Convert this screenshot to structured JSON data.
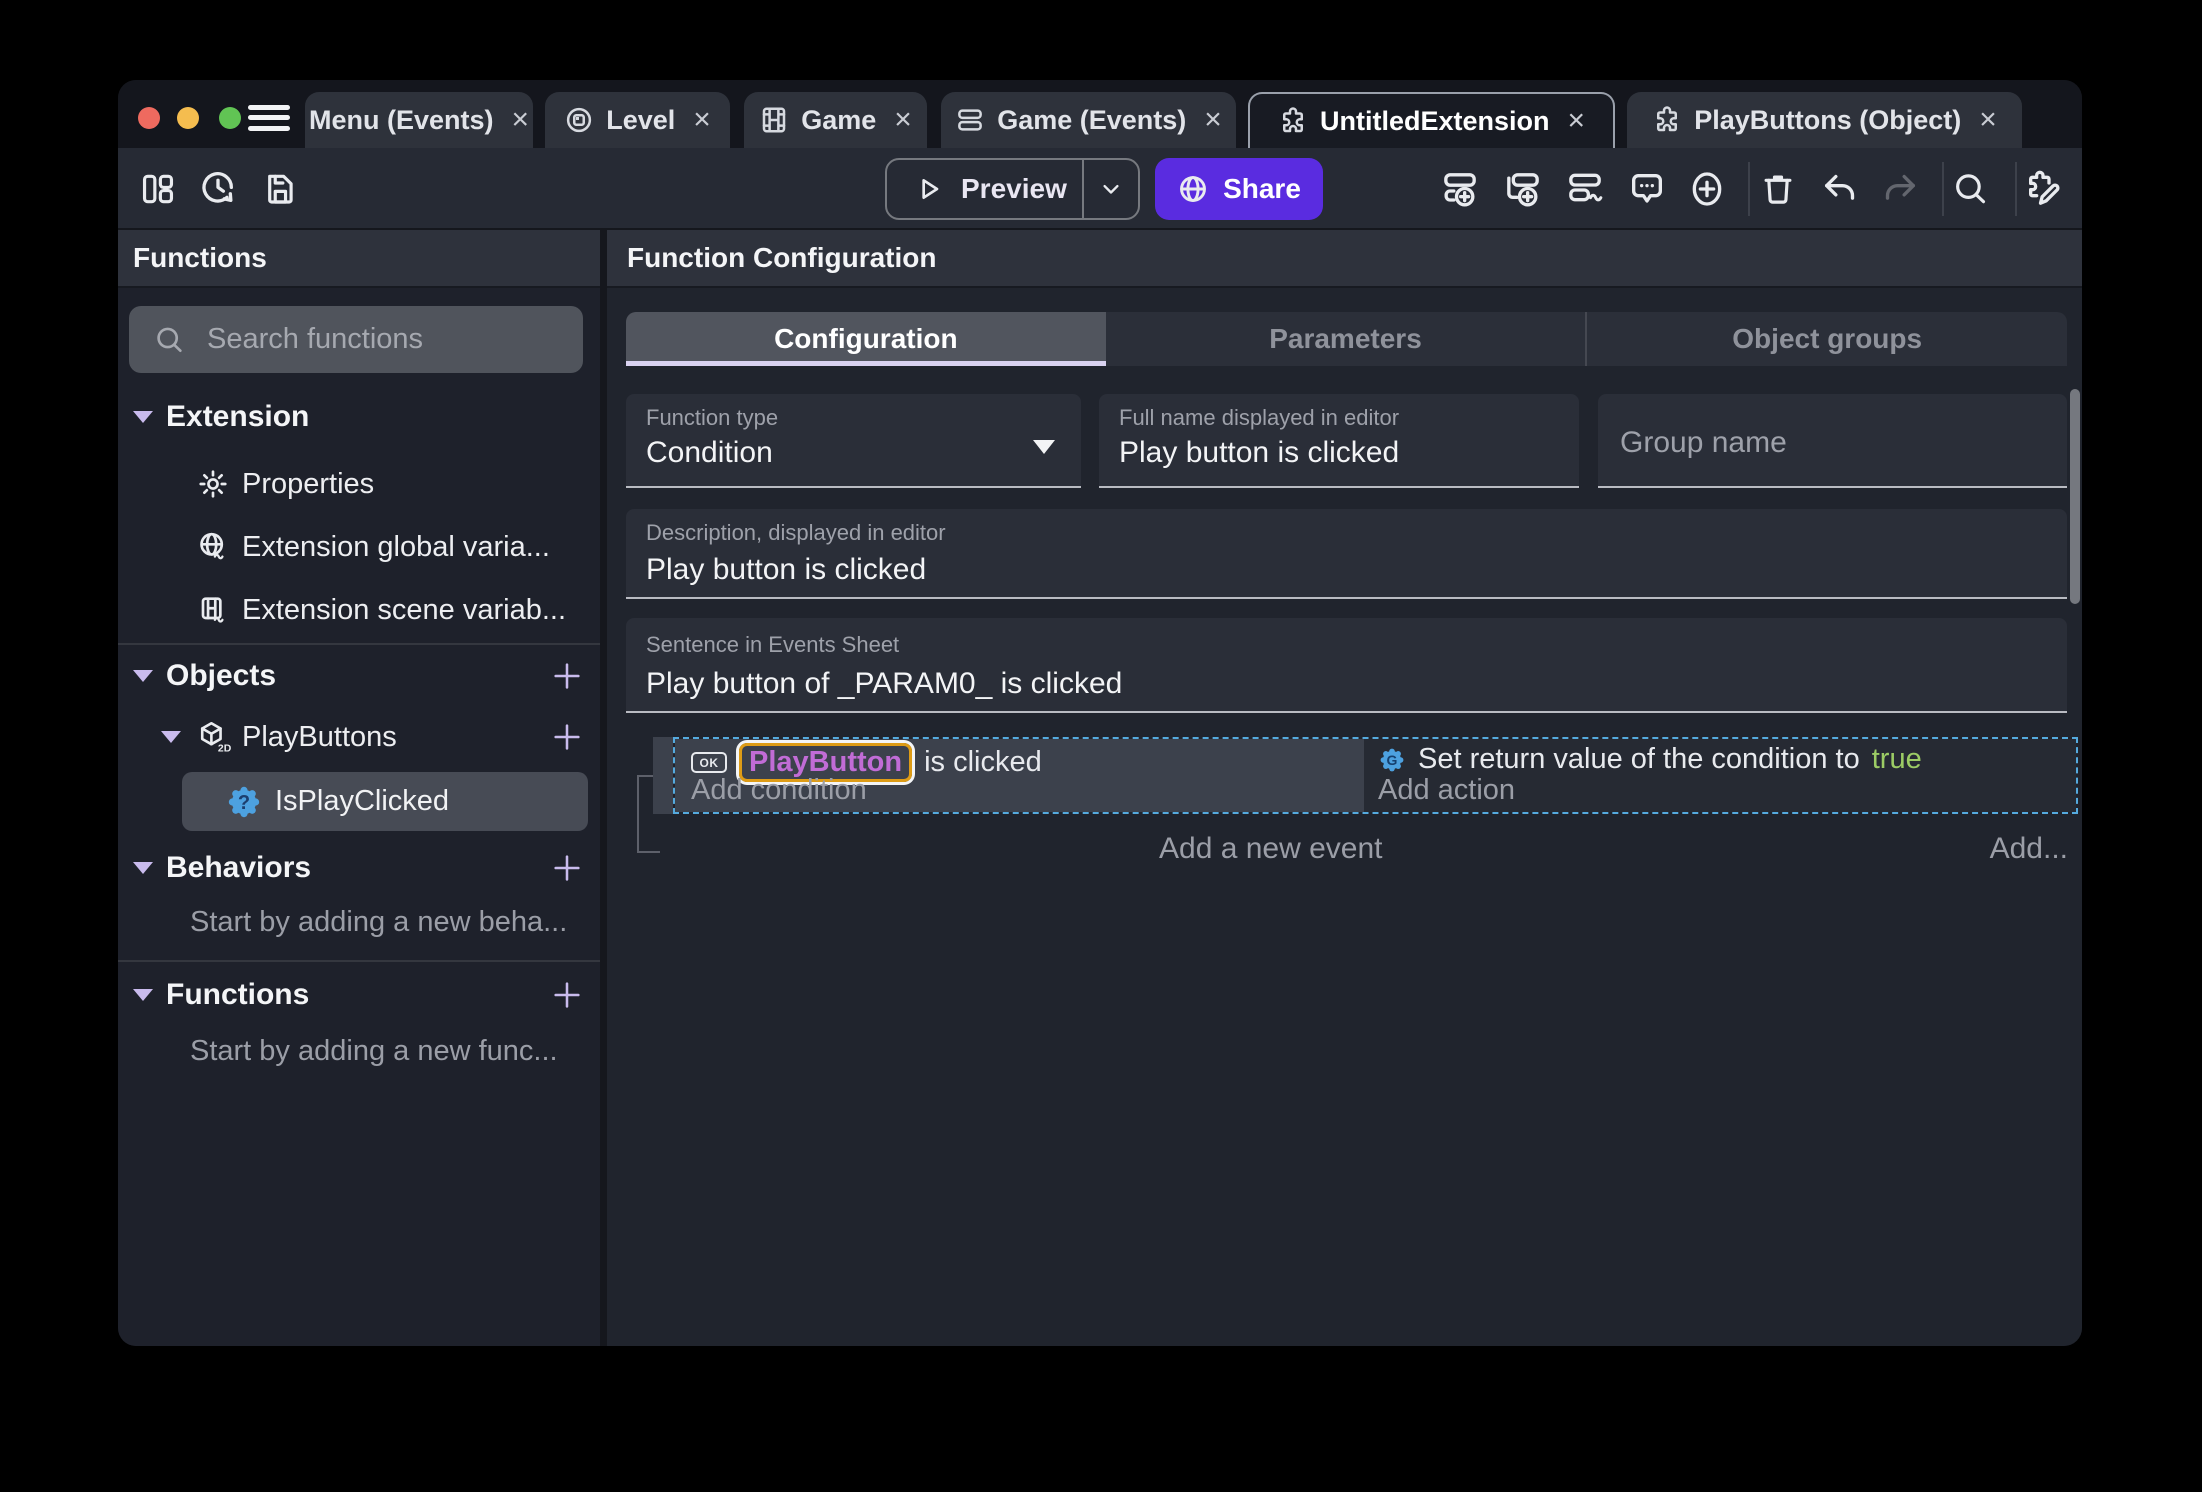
{
  "window": {
    "close_glyph": "×",
    "tabs": [
      {
        "label": "Menu (Events)",
        "icon": null
      },
      {
        "label": "Level",
        "icon": "level-icon"
      },
      {
        "label": "Game",
        "icon": "film-icon"
      },
      {
        "label": "Game (Events)",
        "icon": "events-sheet-icon"
      },
      {
        "label": "UntitledExtension",
        "icon": "puzzle-icon",
        "active": true
      },
      {
        "label": "PlayButtons (Object)",
        "icon": "puzzle-icon"
      }
    ]
  },
  "toolbar": {
    "preview_label": "Preview",
    "share_label": "Share"
  },
  "sidebar": {
    "header": "Functions",
    "search_placeholder": "Search functions",
    "extension": {
      "title": "Extension",
      "items": [
        "Properties",
        "Extension global varia...",
        "Extension scene variab..."
      ]
    },
    "objects": {
      "title": "Objects",
      "object_name": "PlayButtons",
      "function_name": "IsPlayClicked"
    },
    "behaviors": {
      "title": "Behaviors",
      "empty": "Start by adding a new beha..."
    },
    "functions": {
      "title": "Functions",
      "empty": "Start by adding a new func..."
    }
  },
  "main": {
    "header": "Function Configuration",
    "tabs": [
      "Configuration",
      "Parameters",
      "Object groups"
    ],
    "fields": {
      "function_type": {
        "label": "Function type",
        "value": "Condition"
      },
      "full_name": {
        "label": "Full name displayed in editor",
        "value": "Play button is clicked"
      },
      "group_name": {
        "placeholder": "Group name"
      },
      "description": {
        "label": "Description, displayed in editor",
        "value": "Play button is clicked"
      },
      "sentence": {
        "label": "Sentence in Events Sheet",
        "value": "Play button of _PARAM0_ is clicked"
      }
    }
  },
  "events": {
    "condition": {
      "badge": "OK",
      "object": "PlayButton",
      "rest": " is clicked",
      "add_label": "Add condition"
    },
    "action": {
      "prefix": "Set return value of the condition to ",
      "value": "true",
      "add_label": "Add action"
    },
    "add_event_label": "Add a new event",
    "add_more_label": "Add..."
  },
  "colors": {
    "share_button": "#5a2ce0",
    "accent_lavender": "#c9bbed",
    "selected_instruction_border": "#de9c16",
    "object_text": "#c16cd6",
    "boolean_true": "#9ccc65",
    "event_selection_dashed": "#55aade",
    "condition_icon_blue": "#4da1e0",
    "traffic_red": "#ee6a5f",
    "traffic_yellow": "#f5bd4f",
    "traffic_green": "#61c454"
  }
}
